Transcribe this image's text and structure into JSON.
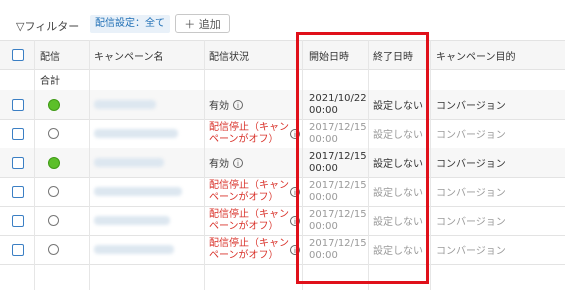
{
  "toolbar": {
    "filter_label": "フィルター",
    "delivery_chip": "配信設定：全て",
    "add_label": "追加"
  },
  "columns": {
    "delivery": "配信",
    "campaign_name": "キャンペーン名",
    "delivery_status": "配信状況",
    "start_date": "開始日時",
    "end_date": "終了日時",
    "objective": "キャンペーン目的"
  },
  "total_row": {
    "label": "合計"
  },
  "rows": [
    {
      "delivery_on": true,
      "status": "有効",
      "start": "2021/10/22 00:00",
      "end": "設定しない",
      "objective": "コンバージョン",
      "active": true
    },
    {
      "delivery_on": false,
      "status": "配信停止（キャンペーンがオフ）",
      "start": "2017/12/15 00:00",
      "end": "設定しない",
      "objective": "コンバージョン",
      "active": false
    },
    {
      "delivery_on": true,
      "status": "有効",
      "start": "2017/12/15 00:00",
      "end": "設定しない",
      "objective": "コンバージョン",
      "active": true
    },
    {
      "delivery_on": false,
      "status": "配信停止（キャンペーンがオフ）",
      "start": "2017/12/15 00:00",
      "end": "設定しない",
      "objective": "コンバージョン",
      "active": false
    },
    {
      "delivery_on": false,
      "status": "配信停止（キャンペーンがオフ）",
      "start": "2017/12/15 00:00",
      "end": "設定しない",
      "objective": "コンバージョン",
      "active": false
    },
    {
      "delivery_on": false,
      "status": "配信停止（キャンペーンがオフ）",
      "start": "2017/12/15 00:00",
      "end": "設定しない",
      "objective": "コンバージョン",
      "active": false
    }
  ],
  "colors": {
    "highlight": "#e0101a",
    "status_stopped": "#d9332b",
    "delivery_on": "#5cbf2a"
  }
}
